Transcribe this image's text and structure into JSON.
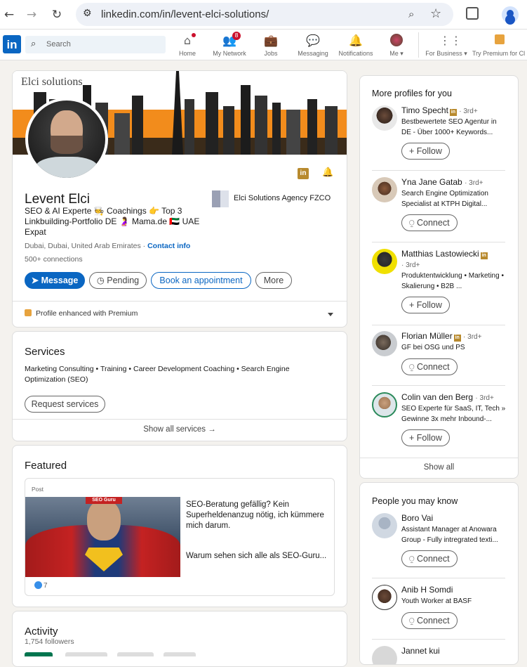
{
  "browser": {
    "url": "linkedin.com/in/levent-elci-solutions/"
  },
  "nav": {
    "logo": "in",
    "search_placeholder": "Search",
    "items": [
      {
        "label": "Home",
        "badge": ""
      },
      {
        "label": "My Network",
        "badge": "8"
      },
      {
        "label": "Jobs",
        "badge": ""
      },
      {
        "label": "Messaging",
        "badge": ""
      },
      {
        "label": "Notifications",
        "badge": ""
      },
      {
        "label": "Me",
        "badge": ""
      }
    ],
    "for_business": "For Business",
    "try_premium": "Try Premium for Cl"
  },
  "profile": {
    "banner_logo": "Elci solutions",
    "name": "Levent Elci",
    "headline": "SEO & AI Experte 🧑‍🍳 Coachings 👉 Top 3 Linkbuilding-Portfolio DE 🤰 Mama.de 🇦🇪 UAE Expat",
    "location": "Dubai, Dubai, United Arab Emirates",
    "contact_info": "Contact info",
    "connections": "500+ connections",
    "company": "Elci Solutions Agency FZCO",
    "buttons": {
      "message": "Message",
      "pending": "Pending",
      "book": "Book an appointment",
      "more": "More"
    },
    "premium_note": "Profile enhanced with Premium"
  },
  "services": {
    "title": "Services",
    "list": "Marketing Consulting • Training • Career Development Coaching • Search Engine Optimization (SEO)",
    "request_button": "Request services",
    "show_all": "Show all services →"
  },
  "featured": {
    "title": "Featured",
    "tag": "Post",
    "image_label": "SEO Guru",
    "text1": "SEO-Beratung gefällig? Kein Superheldenanzug nötig, ich kümmere mich darum.",
    "text2": "Warum sehen sich alle als SEO-Guru...",
    "likes": "7"
  },
  "activity": {
    "title": "Activity",
    "followers": "1,754 followers"
  },
  "more_profiles": {
    "title": "More profiles for you",
    "people": [
      {
        "name": "Timo Specht",
        "degree": "· 3rd+",
        "premium": true,
        "desc": "Bestbewertete SEO Agentur in DE - Über 1000+ Keywords...",
        "action": "Follow"
      },
      {
        "name": "Yna Jane Gatab",
        "degree": "· 3rd+",
        "premium": false,
        "desc": "Search Engine Optimization Specialist at KTPH Digital...",
        "action": "Connect"
      },
      {
        "name": "Matthias Lastowiecki",
        "degree": "· 3rd+",
        "premium": true,
        "desc": "Produktentwicklung • Marketing • Skalierung • B2B ...",
        "action": "Follow"
      },
      {
        "name": "Florian Müller",
        "degree": "· 3rd+",
        "premium": true,
        "desc": "GF bei OSG und PS",
        "action": "Connect"
      },
      {
        "name": "Colin van den Berg",
        "degree": "· 3rd+",
        "premium": false,
        "desc": "SEO Experte für SaaS, IT, Tech » Gewinne 3x mehr Inbound-...",
        "action": "Follow"
      }
    ],
    "show_all": "Show all"
  },
  "people_you_may_know": {
    "title": "People you may know",
    "people": [
      {
        "name": "Boro Vai",
        "desc": "Assistant Manager at Anowara Group - Fully intregrated texti...",
        "action": "Connect"
      },
      {
        "name": "Anib H Somdi",
        "desc": "Youth Worker at BASF",
        "action": "Connect"
      },
      {
        "name": "Jannet kui",
        "desc": "",
        "action": ""
      }
    ]
  }
}
